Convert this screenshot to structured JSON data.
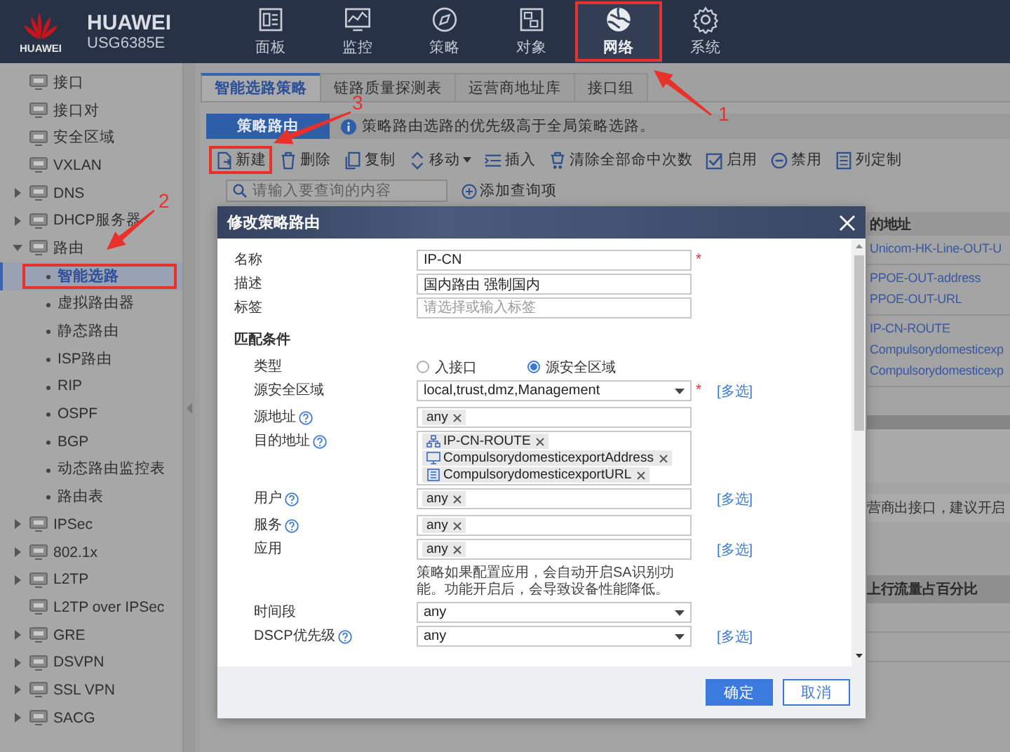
{
  "header": {
    "logo_text": "HUAWEI",
    "brand": "HUAWEI",
    "model": "USG6385E"
  },
  "nav": [
    {
      "label": "面板",
      "selected": false,
      "highlighted": false
    },
    {
      "label": "监控",
      "selected": false,
      "highlighted": false
    },
    {
      "label": "策略",
      "selected": false,
      "highlighted": false
    },
    {
      "label": "对象",
      "selected": false,
      "highlighted": false
    },
    {
      "label": "网络",
      "selected": true,
      "highlighted": true
    },
    {
      "label": "系统",
      "selected": false,
      "highlighted": false
    }
  ],
  "sidebar": {
    "items": [
      {
        "label": "接口"
      },
      {
        "label": "接口对"
      },
      {
        "label": "安全区域"
      },
      {
        "label": "VXLAN"
      },
      {
        "label": "DNS",
        "expanded": false
      },
      {
        "label": "DHCP服务器",
        "expanded": false
      },
      {
        "label": "路由",
        "expanded": true,
        "children": [
          {
            "label": "智能选路",
            "selected": true,
            "highlighted": true
          },
          {
            "label": "虚拟路由器",
            "selected": false,
            "highlighted": false
          },
          {
            "label": "静态路由",
            "selected": false,
            "highlighted": false
          },
          {
            "label": "ISP路由",
            "selected": false,
            "highlighted": false
          },
          {
            "label": "RIP",
            "selected": false,
            "highlighted": false
          },
          {
            "label": "OSPF",
            "selected": false,
            "highlighted": false
          },
          {
            "label": "BGP",
            "selected": false,
            "highlighted": false
          },
          {
            "label": "动态路由监控表",
            "selected": false,
            "highlighted": false
          },
          {
            "label": "路由表",
            "selected": false,
            "highlighted": false
          }
        ]
      },
      {
        "label": "IPSec",
        "expanded": false
      },
      {
        "label": "802.1x",
        "expanded": false
      },
      {
        "label": "L2TP",
        "expanded": false
      },
      {
        "label": "L2TP over IPSec"
      },
      {
        "label": "GRE",
        "expanded": false
      },
      {
        "label": "DSVPN",
        "expanded": false
      },
      {
        "label": "SSL VPN",
        "expanded": false
      },
      {
        "label": "SACG",
        "expanded": false
      }
    ]
  },
  "tabs": [
    {
      "label": "智能选路策略",
      "selected": true
    },
    {
      "label": "链路质量探测表",
      "selected": false
    },
    {
      "label": "运营商地址库",
      "selected": false
    },
    {
      "label": "接口组",
      "selected": false
    }
  ],
  "sub_tab": {
    "label": "策略路由",
    "selected": true
  },
  "info": "策略路由选路的优先级高于全局策略选路。",
  "toolbar": [
    {
      "label": "新建",
      "highlighted": true,
      "dropdown": false
    },
    {
      "label": "删除",
      "highlighted": false,
      "dropdown": false
    },
    {
      "label": "复制",
      "highlighted": false,
      "dropdown": false
    },
    {
      "label": "移动",
      "highlighted": false,
      "dropdown": true
    },
    {
      "label": "插入",
      "highlighted": false,
      "dropdown": false
    },
    {
      "label": "清除全部命中次数",
      "highlighted": false,
      "dropdown": false
    },
    {
      "label": "启用",
      "highlighted": false,
      "dropdown": false
    },
    {
      "label": "禁用",
      "highlighted": false,
      "dropdown": false
    },
    {
      "label": "列定制",
      "highlighted": false,
      "dropdown": false
    }
  ],
  "search": {
    "placeholder": "请输入要查询的内容",
    "add_query": "添加查询项"
  },
  "background_table": {
    "column_header": "的地址",
    "row_groups": [
      [
        "Unicom-HK-Line-OUT-U"
      ],
      [
        "PPOE-OUT-address",
        "PPOE-OUT-URL"
      ],
      [
        "IP-CN-ROUTE",
        "Compulsorydomesticexp",
        "Compulsorydomesticexp"
      ]
    ],
    "note": "营商出接口，建议开启",
    "second_header": "上行流量占百分比"
  },
  "dialog": {
    "title": "修改策略路由",
    "fields": [
      {
        "kind": "text",
        "label": "名称",
        "value": "IP-CN",
        "required_mark": "*"
      },
      {
        "kind": "text",
        "label": "描述",
        "value": "国内路由 强制国内"
      },
      {
        "kind": "text",
        "label": "标签",
        "placeholder": "请选择或输入标签"
      },
      {
        "kind": "heading",
        "label": "匹配条件"
      },
      {
        "kind": "radio",
        "label": "类型",
        "options": [
          {
            "label": "入接口",
            "selected": false
          },
          {
            "label": "源安全区域",
            "selected": true
          }
        ]
      },
      {
        "kind": "select",
        "label": "源安全区域",
        "value": "local,trust,dmz,Management",
        "required_mark": "*",
        "link": "[多选]"
      },
      {
        "kind": "tags",
        "label": "源地址",
        "help": true,
        "tags": [
          {
            "kind": "plain",
            "label": "any"
          }
        ]
      },
      {
        "kind": "tags",
        "label": "目的地址",
        "help": true,
        "tags": [
          {
            "kind": "group",
            "label": "IP-CN-ROUTE"
          },
          {
            "kind": "address",
            "label": "CompulsorydomesticexportAddress"
          },
          {
            "kind": "domain",
            "label": "CompulsorydomesticexportURL"
          }
        ]
      },
      {
        "kind": "tags",
        "label": "用户",
        "help": true,
        "link": "[多选]",
        "tags": [
          {
            "kind": "plain",
            "label": "any"
          }
        ]
      },
      {
        "kind": "tags",
        "label": "服务",
        "help": true,
        "tags": [
          {
            "kind": "plain",
            "label": "any"
          }
        ]
      },
      {
        "kind": "tags",
        "label": "应用",
        "link": "[多选]",
        "tags": [
          {
            "kind": "plain",
            "label": "any"
          }
        ]
      },
      {
        "kind": "note",
        "text": "策略如果配置应用，会自动开启SA识别功能。功能开启后，会导致设备性能降低。"
      },
      {
        "kind": "select",
        "label": "时间段",
        "value": "any"
      },
      {
        "kind": "select",
        "label": "DSCP优先级",
        "help": true,
        "value": "any",
        "link": "[多选]"
      }
    ],
    "buttons": [
      {
        "label": "确定",
        "kind": "primary"
      },
      {
        "label": "取消",
        "kind": "secondary"
      }
    ]
  },
  "annotations": [
    {
      "label": "1"
    },
    {
      "label": "2"
    },
    {
      "label": "3"
    }
  ]
}
